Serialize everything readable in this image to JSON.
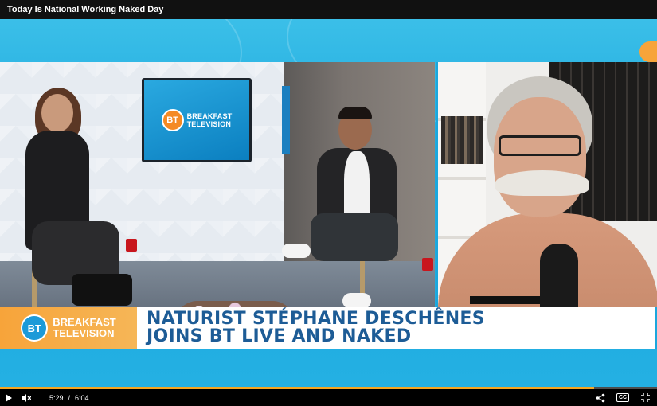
{
  "page": {
    "title": "Today Is National Working Naked Day"
  },
  "studio": {
    "monitor_brand_line1": "BREAKFAST",
    "monitor_brand_line2": "TELEVISION",
    "logo_text": "BT"
  },
  "lower_third": {
    "brand_line1": "BREAKFAST",
    "brand_line2": "TELEVISION",
    "logo_text": "BT",
    "headline_line1": "NATURIST STÉPHANE DESCHÊNES",
    "headline_line2": "JOINS BT LIVE AND NAKED"
  },
  "player": {
    "current_time": "5:29",
    "separator": "/",
    "duration": "6:04",
    "progress_fraction": 0.904,
    "play_icon": "play-icon",
    "mute_icon": "volume-muted-icon",
    "share_icon": "share-icon",
    "cc_icon": "closed-captions-icon",
    "cc_label": "CC",
    "fullscreen_icon": "exit-fullscreen-icon"
  },
  "colors": {
    "accent_orange": "#f5a623",
    "brand_blue": "#1aa7dd",
    "headline_blue": "#1d5c96"
  }
}
